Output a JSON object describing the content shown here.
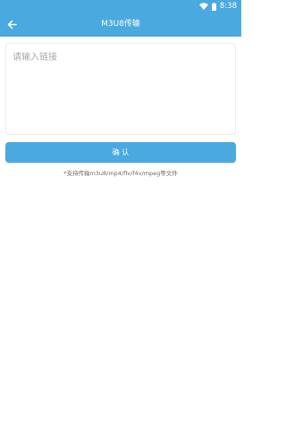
{
  "colors": {
    "accent": "#4aa9de",
    "background": "#ffffff",
    "status_text": "#ffffff"
  },
  "status_bar": {
    "time": "8:38",
    "icons": [
      "wifi-icon",
      "battery-icon"
    ]
  },
  "app_bar": {
    "back_icon": "arrow-left-icon",
    "title": "M3U8传输"
  },
  "link_input": {
    "placeholder": "请输入链接",
    "value": ""
  },
  "confirm_button": {
    "label": "确 认"
  },
  "hint": {
    "text": "*支持传输m3u8/mp4/flv/f4v/mpeg等文件"
  }
}
